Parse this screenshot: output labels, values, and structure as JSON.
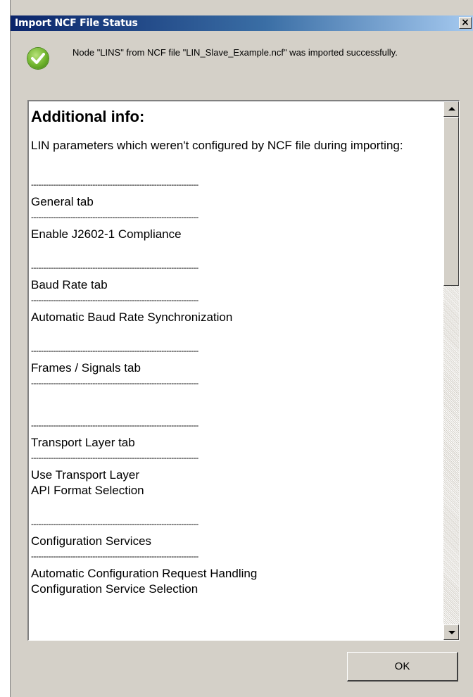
{
  "window": {
    "title": "Import NCF File Status",
    "close_label": "×"
  },
  "status": {
    "icon": "check-circle-icon",
    "message": "Node \"LINS\" from NCF file \"LIN_Slave_Example.ncf\" was imported successfully."
  },
  "info": {
    "heading": "Additional info:",
    "intro": "LIN parameters which weren't configured by NCF file during importing:",
    "separator": "--------------------------------------------------------------------",
    "lines": [
      "General tab",
      "Enable J2602-1 Compliance",
      "Baud Rate tab",
      "Automatic Baud Rate Synchronization",
      "Frames / Signals tab",
      "Transport Layer tab",
      "Use Transport Layer",
      "API Format Selection",
      "Configuration Services",
      "Automatic Configuration Request Handling",
      "Configuration Service Selection"
    ]
  },
  "buttons": {
    "ok_label": "OK"
  }
}
